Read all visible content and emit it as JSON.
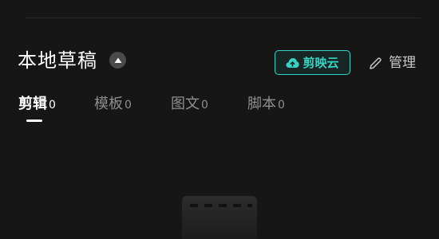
{
  "header": {
    "title": "本地草稿",
    "cloud_button_label": "剪映云",
    "manage_label": "管理"
  },
  "tabs": [
    {
      "label": "剪辑",
      "count": "0",
      "active": true
    },
    {
      "label": "模板",
      "count": "0",
      "active": false
    },
    {
      "label": "图文",
      "count": "0",
      "active": false
    },
    {
      "label": "脚本",
      "count": "0",
      "active": false
    }
  ],
  "colors": {
    "background": "#161616",
    "accent": "#34d4c4",
    "text_primary": "#ffffff",
    "text_secondary": "#8f8f8f"
  },
  "icons": {
    "collapse": "triangle-up-icon",
    "cloud": "cloud-upload-icon",
    "manage": "pencil-icon",
    "empty_state": "film-strip-icon"
  }
}
